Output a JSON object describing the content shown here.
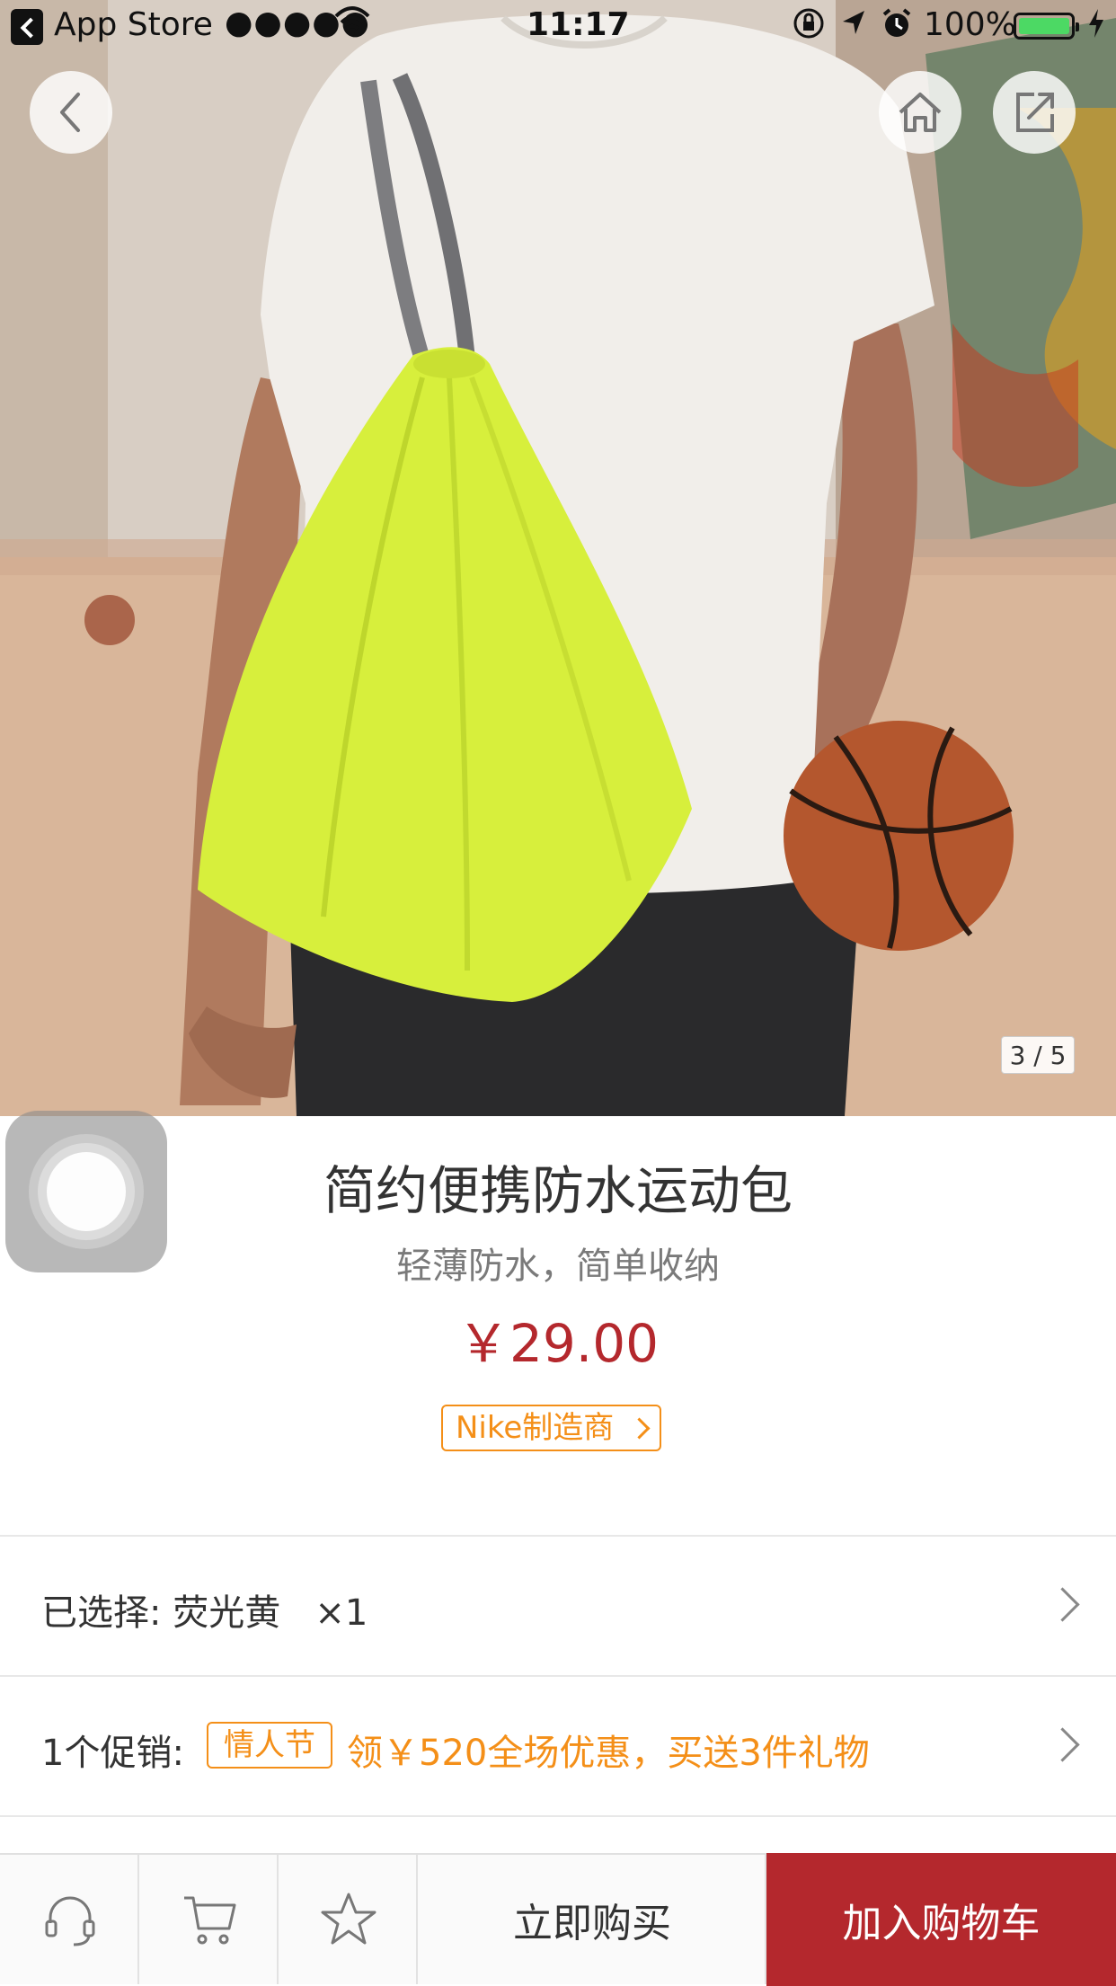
{
  "status_bar": {
    "back_app": "App Store",
    "signal": "●●●●●",
    "time": "11:17",
    "battery": "100%"
  },
  "gallery": {
    "counter": "3 / 5"
  },
  "product": {
    "title": "简约便携防水运动包",
    "subtitle": "轻薄防水，简单收纳",
    "price": "￥29.00",
    "brand_tag": "Nike制造商"
  },
  "spec_row": {
    "label": "已选择: 荧光黄   ×1"
  },
  "promo_row": {
    "label": "1个促销:",
    "tag": "情人节",
    "text": "领￥520全场优惠，买送3件礼物"
  },
  "bottom_bar": {
    "buy_now": "立即购买",
    "add_to_cart": "加入购物车"
  },
  "icons": [
    "back-icon",
    "home-icon",
    "share-icon",
    "customer-service-icon",
    "cart-icon",
    "favorite-star-icon"
  ],
  "colors": {
    "accent": "#b4282d",
    "promo_orange": "#f48f18",
    "bag_yellow": "#d7ef3c"
  }
}
